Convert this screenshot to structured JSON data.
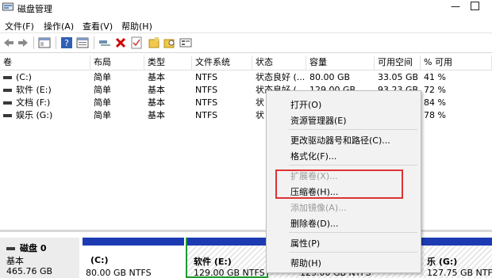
{
  "window": {
    "title": "磁盘管理",
    "minimize_glyph": "—"
  },
  "menu": [
    "文件(F)",
    "操作(A)",
    "查看(V)",
    "帮助(H)"
  ],
  "toolbar_icons": [
    "back-arrow-icon",
    "forward-arrow-icon",
    "console-tree-icon",
    "help-icon",
    "properties-icon",
    "connect-icon",
    "delete-icon",
    "checklist-icon",
    "new-folder-icon",
    "search-folder-icon",
    "disk-list-icon"
  ],
  "table": {
    "headers": [
      "卷",
      "布局",
      "类型",
      "文件系统",
      "状态",
      "容量",
      "可用空间",
      "% 可用"
    ],
    "rows": [
      {
        "vol": "(C:)",
        "layout": "简单",
        "type": "基本",
        "fs": "NTFS",
        "status": "状态良好 (...",
        "cap": "80.00 GB",
        "free": "33.05 GB",
        "pct": "41 %"
      },
      {
        "vol": "软件 (E:)",
        "layout": "简单",
        "type": "基本",
        "fs": "NTFS",
        "status": "状态良好 (...",
        "cap": "129.00 GB",
        "free": "93.23 GB",
        "pct": "72 %"
      },
      {
        "vol": "文档 (F:)",
        "layout": "简单",
        "type": "基本",
        "fs": "NTFS",
        "status": "状",
        "cap": "",
        "free": "",
        "pct": "84 %"
      },
      {
        "vol": "娱乐 (G:)",
        "layout": "简单",
        "type": "基本",
        "fs": "NTFS",
        "status": "状",
        "cap": "",
        "free": "",
        "pct": "78 %"
      }
    ]
  },
  "disk": {
    "title": "磁盘 0",
    "kind": "基本",
    "size": "465.76 GB"
  },
  "partitions": [
    {
      "name": "(C:)",
      "size": "80.00 GB NTFS"
    },
    {
      "name": "软件 (E:)",
      "size": "129.00 GB NTFS"
    },
    {
      "name": "",
      "size": "129.00 GB NTFS"
    },
    {
      "name": "乐 (G:)",
      "size": "127.75 GB NTFS"
    }
  ],
  "context_menu": {
    "open": "打开(O)",
    "explorer": "资源管理器(E)",
    "change_letter": "更改驱动器号和路径(C)...",
    "format": "格式化(F)...",
    "extend": "扩展卷(X)...",
    "shrink": "压缩卷(H)...",
    "add_mirror": "添加镜像(A)...",
    "delete": "删除卷(D)...",
    "properties": "属性(P)",
    "help": "帮助(H)"
  },
  "colors": {
    "partition_bar": "#1c3bb3",
    "highlight": "#dd3333",
    "delete_x": "#d00000",
    "selected_partition": "#1e9a2e"
  }
}
